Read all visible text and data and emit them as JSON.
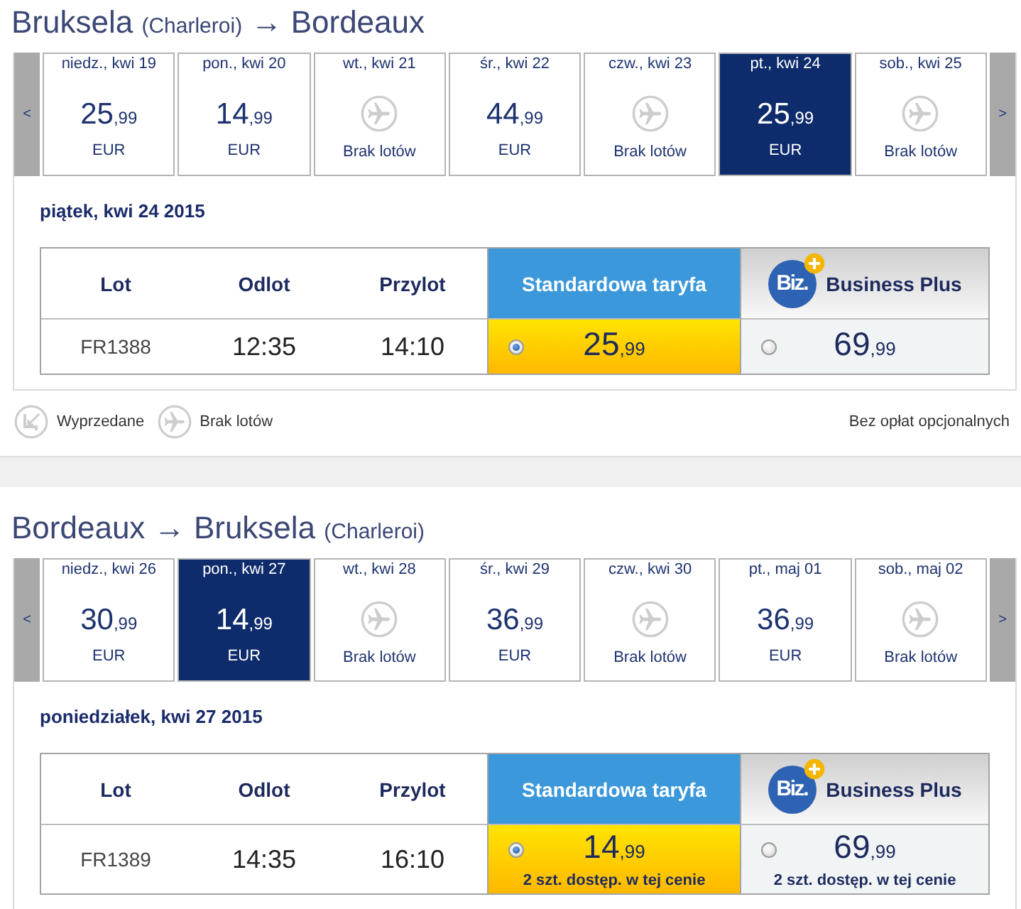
{
  "journeys": [
    {
      "title": [
        {
          "kind": "city",
          "text": "Bruksela"
        },
        {
          "kind": "note",
          "text": "(Charleroi)"
        },
        {
          "kind": "arrow",
          "text": "→"
        },
        {
          "kind": "city",
          "text": "Bordeaux"
        }
      ],
      "prev_label": "<",
      "next_label": ">",
      "dates": [
        {
          "label": "niedz., kwi 19",
          "kind": "fare",
          "price": "25,99",
          "currency": "EUR",
          "selected": false
        },
        {
          "label": "pon., kwi 20",
          "kind": "fare",
          "price": "14,99",
          "currency": "EUR",
          "selected": false
        },
        {
          "label": "wt., kwi 21",
          "kind": "no_flights",
          "status": "Brak lotów",
          "selected": false
        },
        {
          "label": "śr., kwi 22",
          "kind": "fare",
          "price": "44,99",
          "currency": "EUR",
          "selected": false
        },
        {
          "label": "czw., kwi 23",
          "kind": "no_flights",
          "status": "Brak lotów",
          "selected": false
        },
        {
          "label": "pt., kwi 24",
          "kind": "fare",
          "price": "25,99",
          "currency": "EUR",
          "selected": true
        },
        {
          "label": "sob., kwi 25",
          "kind": "no_flights",
          "status": "Brak lotów",
          "selected": false
        }
      ],
      "day": "piątek, kwi 24 2015",
      "columns": [
        "Lot",
        "Odlot",
        "Przylot"
      ],
      "fare_types": [
        {
          "kind": "standard",
          "label": "Standardowa taryfa"
        },
        {
          "kind": "business",
          "label": "Business Plus",
          "logo": "Biz."
        }
      ],
      "flights": [
        {
          "number": "FR1388",
          "departure": "12:35",
          "arrival": "14:10",
          "fares": [
            {
              "price": "25,99",
              "selected": true
            },
            {
              "price": "69,99",
              "selected": false
            }
          ]
        }
      ],
      "legend": {
        "items": [
          {
            "kind": "sold_out",
            "label": "Wyprzedane"
          },
          {
            "kind": "no_flights",
            "label": "Brak lotów"
          }
        ],
        "note": "Bez opłat opcjonalnych"
      }
    },
    {
      "title": [
        {
          "kind": "city",
          "text": "Bordeaux"
        },
        {
          "kind": "arrow",
          "text": "→"
        },
        {
          "kind": "city",
          "text": "Bruksela"
        },
        {
          "kind": "note",
          "text": "(Charleroi)"
        }
      ],
      "prev_label": "<",
      "next_label": ">",
      "dates": [
        {
          "label": "niedz., kwi 26",
          "kind": "fare",
          "price": "30,99",
          "currency": "EUR",
          "selected": false
        },
        {
          "label": "pon., kwi 27",
          "kind": "fare",
          "price": "14,99",
          "currency": "EUR",
          "selected": true
        },
        {
          "label": "wt., kwi 28",
          "kind": "no_flights",
          "status": "Brak lotów",
          "selected": false
        },
        {
          "label": "śr., kwi 29",
          "kind": "fare",
          "price": "36,99",
          "currency": "EUR",
          "selected": false
        },
        {
          "label": "czw., kwi 30",
          "kind": "no_flights",
          "status": "Brak lotów",
          "selected": false
        },
        {
          "label": "pt., maj 01",
          "kind": "fare",
          "price": "36,99",
          "currency": "EUR",
          "selected": false
        },
        {
          "label": "sob., maj 02",
          "kind": "no_flights",
          "status": "Brak lotów",
          "selected": false
        }
      ],
      "day": "poniedziałek, kwi 27 2015",
      "columns": [
        "Lot",
        "Odlot",
        "Przylot"
      ],
      "fare_types": [
        {
          "kind": "standard",
          "label": "Standardowa taryfa"
        },
        {
          "kind": "business",
          "label": "Business Plus",
          "logo": "Biz."
        }
      ],
      "flights": [
        {
          "number": "FR1389",
          "departure": "14:35",
          "arrival": "16:10",
          "fares": [
            {
              "price": "14,99",
              "selected": true,
              "availability": "2 szt. dostęp. w tej cenie"
            },
            {
              "price": "69,99",
              "selected": false,
              "availability": "2 szt. dostęp. w tej cenie"
            }
          ]
        }
      ]
    }
  ]
}
